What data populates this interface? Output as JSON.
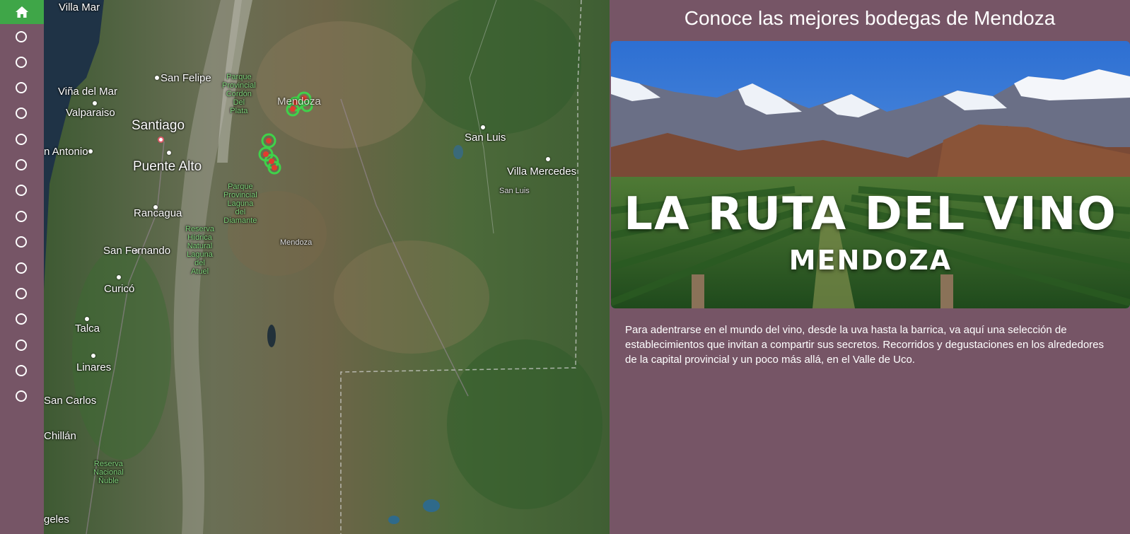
{
  "sidebar": {
    "home_icon": "home-icon",
    "item_count": 15,
    "accent": "#3fa648"
  },
  "map": {
    "labels": {
      "san_felipe": "San Felipe",
      "vina_del_mar": "Viña del Mar",
      "valparaiso": "Valparaiso",
      "santiago": "Santiago",
      "san_antonio": "n Antonio",
      "puente_alto": "Puente Alto",
      "rancagua": "Rancagua",
      "san_fernando": "San Fernando",
      "curico": "Curicó",
      "talca": "Talca",
      "linares": "Linares",
      "san_carlos": "San Carlos",
      "chillan": "Chillán",
      "angeles": "geles",
      "mendoza_city": "Mendoza",
      "mendoza_region": "Mendoza",
      "san_luis": "San Luis",
      "san_luis_region": "San Luis",
      "villa_mercedes": "Villa Mercedes",
      "park_cordon": "Parque\nProvincial\nCordón\nDel\nPlata",
      "park_laguna": "Parque\nProvincial\nLaguna\ndel\nDiamante",
      "reserva_hidrica": "Reserva\nHídrica\nNatural\nLaguna\ndel\nAtuel",
      "reserva_nuble": "Reserva\nNacional\nÑuble",
      "top_fragment": "Villa Mar"
    }
  },
  "panel": {
    "title": "Conoce las mejores bodegas de Mendoza",
    "hero_title": "LA RUTA DEL VINO",
    "hero_subtitle": "MENDOZA",
    "description": "Para adentrarse en el mundo del vino, desde la uva hasta la barrica, va aquí una selección de establecimientos que invitan a compartir sus secretos. Recorridos y degustaciones en los alrededores de la capital provincial y un poco más allá, en el Valle de Uco."
  },
  "colors": {
    "panel_bg": "#765566",
    "marker": "#e23b2e",
    "marker_ring": "#3fd24a"
  }
}
